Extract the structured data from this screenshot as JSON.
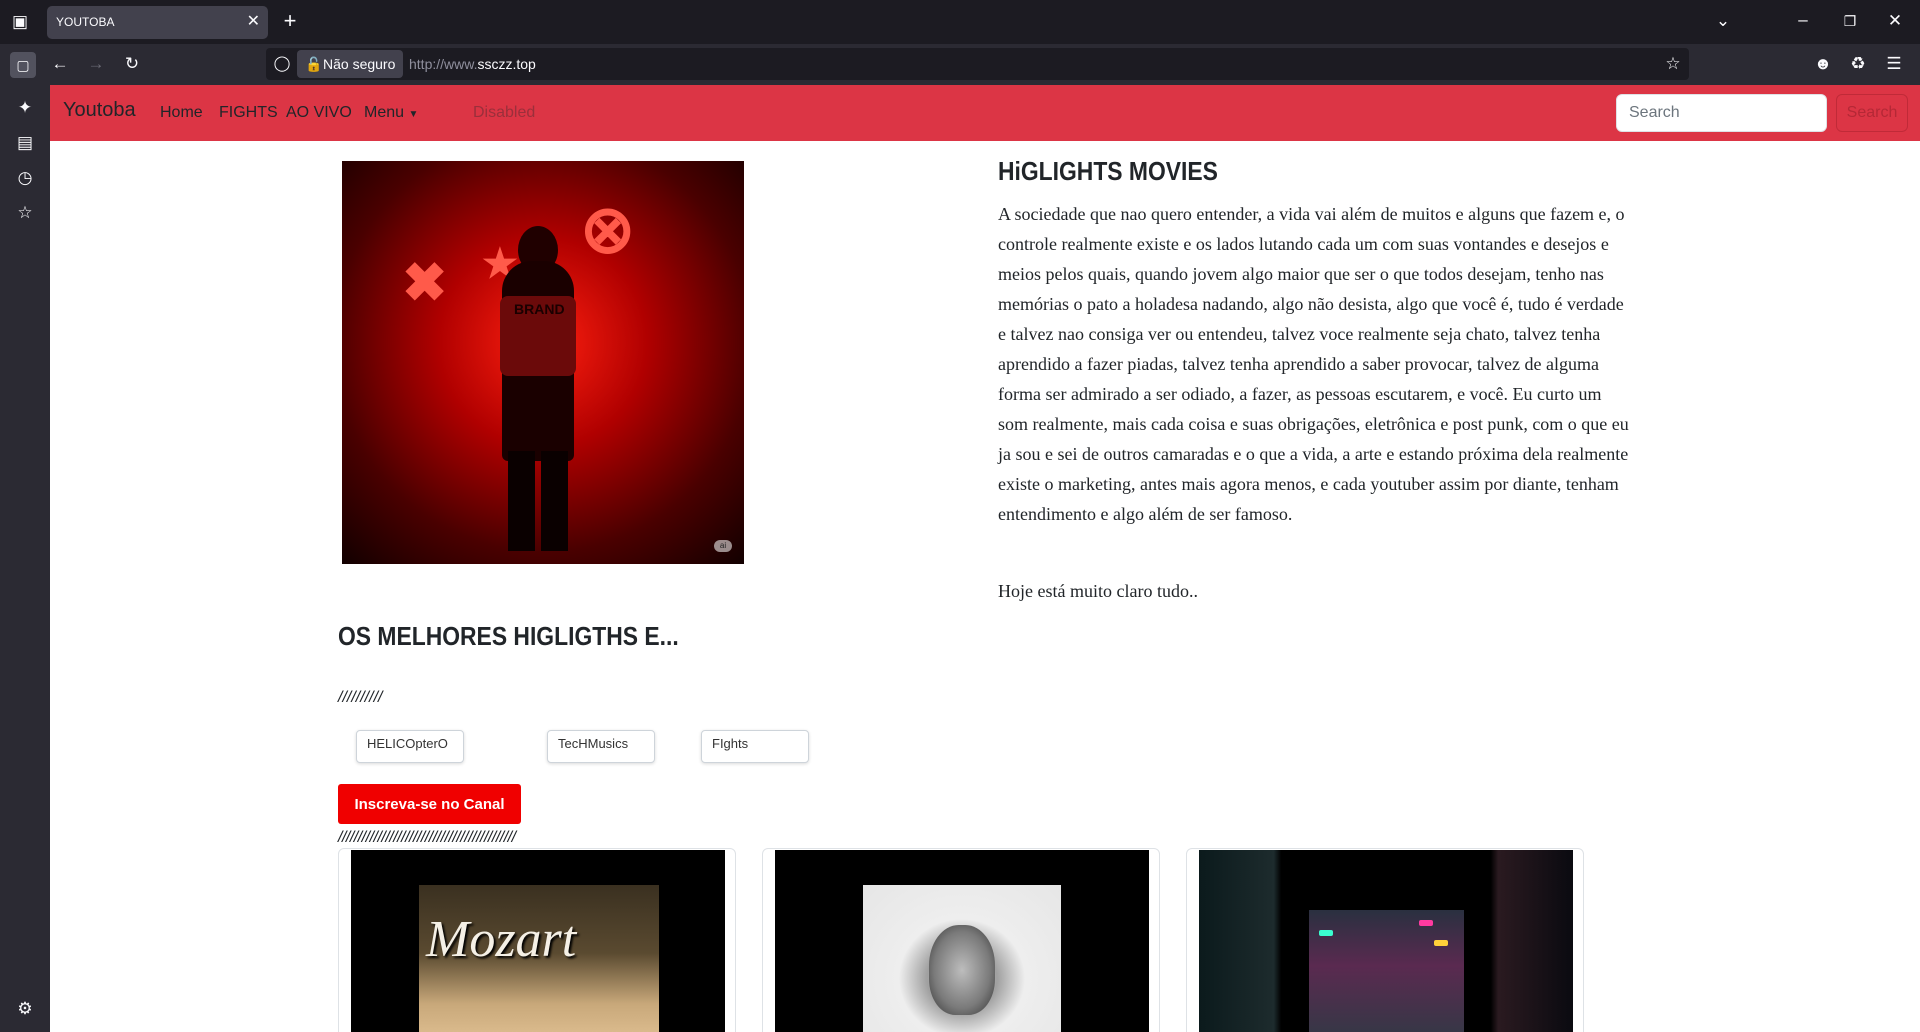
{
  "browser": {
    "tab_title": "YOUTOBA",
    "security_label": "Não seguro",
    "url_prefix": "http://www.",
    "url_domain": "ssczz.top"
  },
  "navbar": {
    "brand": "Youtoba",
    "links": [
      "Home",
      "FIGHTS",
      "AO VIVO",
      "Menu",
      "Disabled"
    ],
    "search_placeholder": "Search",
    "search_button": "Search",
    "bg_color": "#dc3545"
  },
  "hero": {
    "image_badge": "ai",
    "image_shirt_text": "BRAND",
    "title": "HiGLIGHTS MOVIES",
    "paragraph": "A sociedade que nao quero entender, a vida vai além de muitos e alguns que fazem e, o controle realmente existe e os lados lutando cada um com suas vontandes e desejos e meios pelos quais, quando jovem algo maior que ser o que todos desejam, tenho nas memórias o pato a holadesa nadando, algo não desista, algo que você é, tudo é verdade e talvez nao consiga ver ou entendeu, talvez voce realmente seja chato, talvez tenha aprendido a fazer piadas, talvez tenha aprendido a saber provocar, talvez de alguma forma ser admirado a ser odiado, a fazer, as pessoas escutarem, e você. Eu curto um som realmente, mais cada coisa e suas obrigações, eletrônica e post punk, com o que eu ja sou e sei de outros camaradas e o que a vida, a arte e estando próxima dela realmente existe o marketing, antes mais agora menos, e cada youtuber assim por diante, tenham entendimento e algo além de ser famoso.",
    "paragraph2": "Hoje está muito claro tudo.."
  },
  "section": {
    "title": "OS MELHORES HIGLIGTHS E...",
    "divider1": "//////////",
    "tags": [
      "HELICOpterO",
      "TecHMusics",
      "FIghts"
    ],
    "subscribe_button": "Inscreva-se no Canal",
    "subscribe_color": "#f00000",
    "divider2": "/////////////////////////////////////////////",
    "cards": [
      {
        "thumb_text": "Mozart"
      },
      {
        "thumb_text": ""
      },
      {
        "thumb_text": ""
      }
    ]
  }
}
